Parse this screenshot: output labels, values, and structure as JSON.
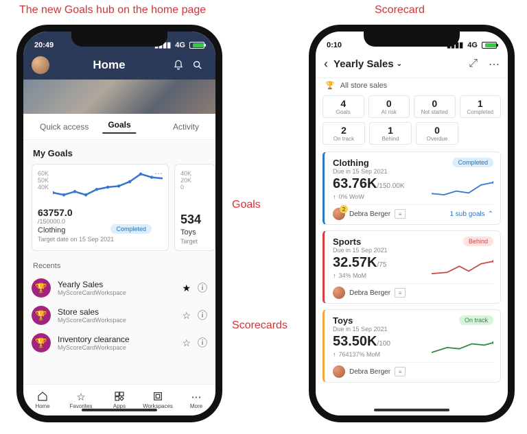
{
  "annotations": {
    "title_left": "The new Goals hub on the home page",
    "title_right": "Scorecard",
    "goals_label": "Goals",
    "scorecards_label": "Scorecards"
  },
  "phone1": {
    "status": {
      "time": "20:49",
      "net": "4G"
    },
    "header": {
      "title": "Home"
    },
    "tabs": {
      "left": "Quick access",
      "center": "Goals",
      "right": "Activity"
    },
    "section_title": "My Goals",
    "goal_cards": [
      {
        "yaxis": [
          "60K",
          "50K",
          "40K"
        ],
        "value": "63757.0",
        "sub": "/150000.0",
        "name": "Clothing",
        "date": "Target date on 15 Sep 2021",
        "status": "Completed"
      },
      {
        "yaxis": [
          "40K",
          "20K",
          "0"
        ],
        "value": "534",
        "name": "Toys",
        "date": "Target"
      }
    ],
    "recents_title": "Recents",
    "recents": [
      {
        "name": "Yearly Sales",
        "workspace": "MyScoreCardWorkspace",
        "starred": true
      },
      {
        "name": "Store sales",
        "workspace": "MyScoreCardWorkspace",
        "starred": false
      },
      {
        "name": "Inventory clearance",
        "workspace": "MyScoreCardWorkspace",
        "starred": false
      }
    ],
    "bottom_nav": [
      {
        "label": "Home"
      },
      {
        "label": "Favorites"
      },
      {
        "label": "Apps"
      },
      {
        "label": "Workspaces"
      },
      {
        "label": "More"
      }
    ]
  },
  "phone2": {
    "status": {
      "time": "0:10",
      "net": "4G"
    },
    "header": {
      "title": "Yearly Sales"
    },
    "all_sales": "All store sales",
    "stats": [
      [
        {
          "v": "4",
          "l": "Goals"
        },
        {
          "v": "0",
          "l": "At risk"
        },
        {
          "v": "0",
          "l": "Not started"
        },
        {
          "v": "1",
          "l": "Completed"
        }
      ],
      [
        {
          "v": "2",
          "l": "On track"
        },
        {
          "v": "1",
          "l": "Behind"
        },
        {
          "v": "0",
          "l": "Overdue"
        }
      ]
    ],
    "cards": [
      {
        "name": "Clothing",
        "due": "Due in 15 Sep 2021",
        "value": "63.76K",
        "target": "/150.00K",
        "delta": "0% WoW",
        "status": "Completed",
        "owner": "Debra Berger",
        "subgoals": "1 sub goals",
        "owner_badge": true,
        "color": "blue"
      },
      {
        "name": "Sports",
        "due": "Due in 15 Sep 2021",
        "value": "32.57K",
        "target": "/75",
        "delta": "34% MoM",
        "status": "Behind",
        "owner": "Debra Berger",
        "color": "red"
      },
      {
        "name": "Toys",
        "due": "Due in 15 Sep 2021",
        "value": "53.50K",
        "target": "/100",
        "delta": "764137% MoM",
        "status": "On track",
        "owner": "Debra Berger",
        "color": "green"
      }
    ]
  },
  "chart_data": [
    {
      "type": "line",
      "title": "Clothing goal trend",
      "ylim": [
        35000,
        65000
      ],
      "x": [
        0,
        1,
        2,
        3,
        4,
        5,
        6,
        7,
        8,
        9
      ],
      "values": [
        41000,
        40000,
        42000,
        40000,
        44000,
        46000,
        47000,
        52000,
        61000,
        57000
      ]
    }
  ]
}
